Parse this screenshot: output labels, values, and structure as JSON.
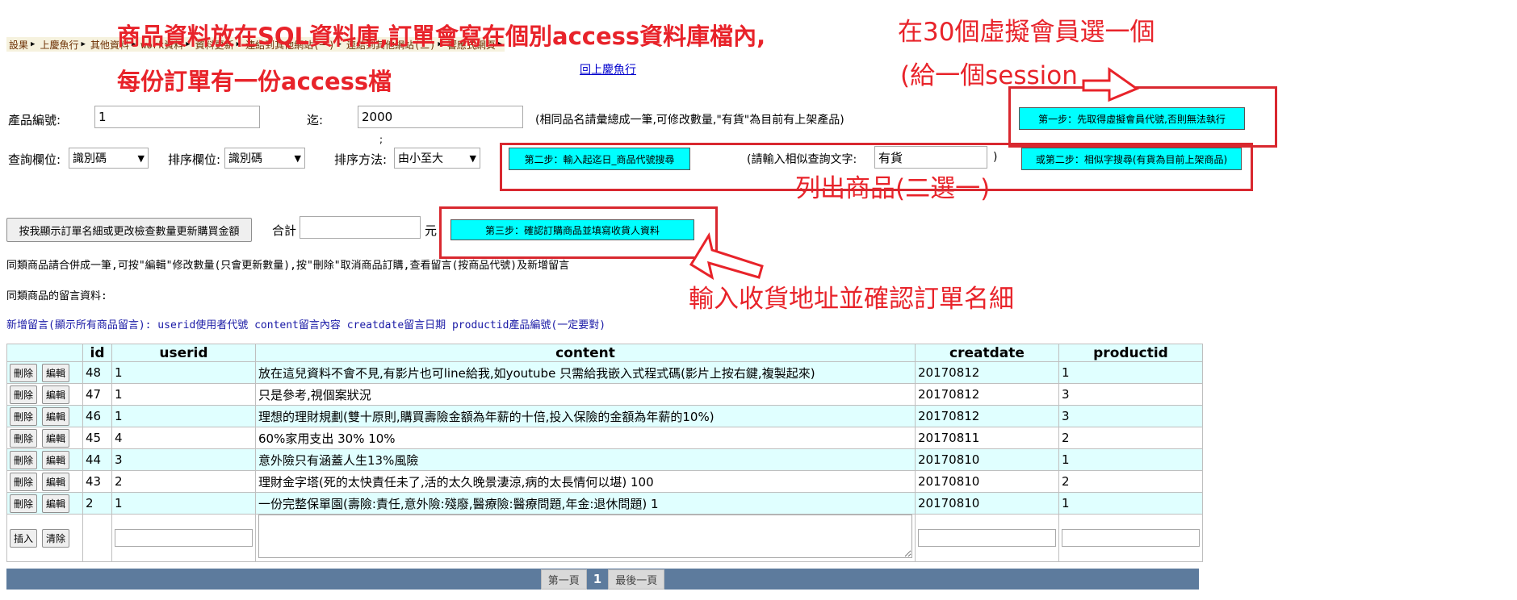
{
  "annotations": {
    "title_line1": "商品資料放在SQL資料庫,訂單會寫在個別access資料庫檔內,",
    "title_line2": "每份訂單有一份access檔",
    "right_line1": "在30個虛擬會員選一個",
    "right_line2": "(給一個session",
    "list_products": "列出商品(二選一)",
    "shipping": "輸入收貨地址並確認訂單名細"
  },
  "menu": [
    "設果",
    "上慶魚行",
    "其他資料",
    "work資料",
    "資料更新",
    "連結到其他網站(一)",
    "連結到其他網站(二)",
    "響應式網頁"
  ],
  "back_link": "回上慶魚行",
  "search": {
    "product_id_label": "產品編號:",
    "product_id_value": "1",
    "to_label": "迄:",
    "to_value": "2000",
    "hint": "(相同品名請彙總成一筆,可修改數量,\"有貨\"為目前有上架產品)",
    "semicolon": ";",
    "query_field_label": "查詢欄位:",
    "query_field_value": "識別碼",
    "sort_field_label": "排序欄位:",
    "sort_field_value": "識別碼",
    "sort_method_label": "排序方法:",
    "sort_method_value": "由小至大",
    "similar_label": "(請輸入相似查詢文字:",
    "similar_value": "有貨",
    "close_paren": ")"
  },
  "buttons": {
    "step1": "第一步：先取得虛擬會員代號,否則無法執行",
    "step2": "第二步：輸入起迄日_商品代號搜尋",
    "step2b": "或第二步：相似字搜尋(有貨為目前上架商品)",
    "step3": "第三步：確認訂購商品並填寫收貨人資料",
    "show_order": "按我顯示訂單名細或更改檢查數量更新購買金額"
  },
  "total": {
    "label": "合計",
    "value": "",
    "unit": "元"
  },
  "notes": {
    "note1": "同類商品請合併成一筆,可按\"編輯\"修改數量(只會更新數量),按\"刪除\"取消商品訂購,查看留言(按商品代號)及新增留言",
    "note2": "同類商品的留言資料:",
    "note3": "新增留言(顯示所有商品留言): userid使用者代號 content留言內容 creatdate留言日期 productid產品編號(一定要對)"
  },
  "grid": {
    "headers": [
      "",
      "id",
      "userid",
      "content",
      "creatdate",
      "productid"
    ],
    "delete_label": "刪除",
    "edit_label": "編輯",
    "insert_label": "插入",
    "clear_label": "清除",
    "rows": [
      {
        "id": "48",
        "userid": "1",
        "content": "放在這兒資料不會不見,有影片也可line給我,如youtube 只需給我嵌入式程式碼(影片上按右鍵,複製起來)",
        "creatdate": "20170812",
        "productid": "1"
      },
      {
        "id": "47",
        "userid": "1",
        "content": "只是參考,視個案狀況",
        "creatdate": "20170812",
        "productid": "3"
      },
      {
        "id": "46",
        "userid": "1",
        "content": "理想的理財規劃(雙十原則,購買壽險金額為年薪的十倍,投入保險的金額為年薪的10%)",
        "creatdate": "20170812",
        "productid": "3"
      },
      {
        "id": "45",
        "userid": "4",
        "content": "60%家用支出 30% 10%",
        "creatdate": "20170811",
        "productid": "2"
      },
      {
        "id": "44",
        "userid": "3",
        "content": "意外險只有涵蓋人生13%風險",
        "creatdate": "20170810",
        "productid": "1"
      },
      {
        "id": "43",
        "userid": "2",
        "content": "理財金字塔(死的太快責任未了,活的太久晚景淒涼,病的太長情何以堪) 100",
        "creatdate": "20170810",
        "productid": "2"
      },
      {
        "id": "2",
        "userid": "1",
        "content": "一份完整保單園(壽險:責任,意外險:殘廢,醫療險:醫療問題,年金:退休問題) 1",
        "creatdate": "20170810",
        "productid": "1"
      }
    ]
  },
  "pager": {
    "first": "第一頁",
    "current": "1",
    "last": "最後一頁"
  },
  "colors": {
    "annotation": "#e8232a",
    "cyan_button": "#00ffff",
    "row_alt": "#e0ffff",
    "pager_bar": "#5d7b9d"
  }
}
